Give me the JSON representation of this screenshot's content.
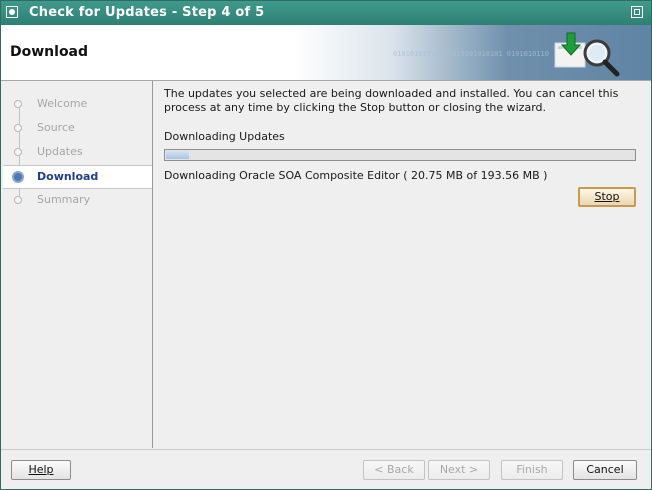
{
  "window": {
    "title": "Check for Updates - Step 4 of 5"
  },
  "header": {
    "title": "Download",
    "binary_text": "01010101010101010101010101  0101010110"
  },
  "nav": {
    "steps": [
      {
        "label": "Welcome"
      },
      {
        "label": "Source"
      },
      {
        "label": "Updates"
      },
      {
        "label": "Download"
      },
      {
        "label": "Summary"
      }
    ],
    "active_index": 3
  },
  "main": {
    "intro_line1": "The updates you selected are being downloaded and installed. You can cancel this",
    "intro_line2": "process at any time by clicking the Stop button or closing the wizard.",
    "downloading_label": "Downloading Updates",
    "status_text": "Downloading Oracle SOA Composite Editor ( 20.75 MB of 193.56 MB )",
    "progress_fraction": 0.05,
    "stop_label": "Stop"
  },
  "footer": {
    "help_label": "Help",
    "back_label": "< Back",
    "next_label": "Next >",
    "finish_label": "Finish",
    "cancel_label": "Cancel"
  },
  "colors": {
    "titlebar": "#2e7f73",
    "active_step_text": "#1f3f8a",
    "progress_fill": "#a9c3e2",
    "stop_border": "#c79a52"
  },
  "icons": {
    "window": "window-menu-icon",
    "maximize": "maximize-icon",
    "header": "download-search-icon"
  }
}
